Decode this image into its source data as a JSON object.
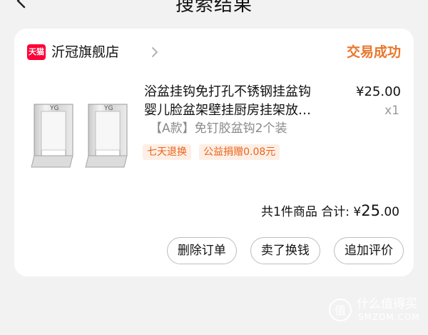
{
  "header": {
    "title": "搜索结果",
    "back_icon": "chevron-left-icon"
  },
  "store": {
    "badge": "天猫",
    "name": "沂冠旗舰店",
    "status": "交易成功",
    "status_color": "#e8772c"
  },
  "product": {
    "title_line1": "浴盆挂钩免打孔不锈钢挂盆钩",
    "title_line2": "婴儿脸盆架壁挂厨房挂架放…",
    "price": "¥25.00",
    "quantity": "x1",
    "variant": "【A款】免钉胶盆钩2个装",
    "tags": [
      "七天退换",
      "公益捐赠0.08元"
    ]
  },
  "summary": {
    "item_count": "共1件商品",
    "total_label": "合计:",
    "currency": "¥",
    "amount_int": "25",
    "amount_dec": ".00"
  },
  "actions": {
    "delete_order": "删除订单",
    "resell": "卖了换钱",
    "add_review": "追加评价"
  },
  "watermark": {
    "title": "什么值得买",
    "subtitle": "SMZDM.COM",
    "icon": "zhi-badge-icon"
  }
}
